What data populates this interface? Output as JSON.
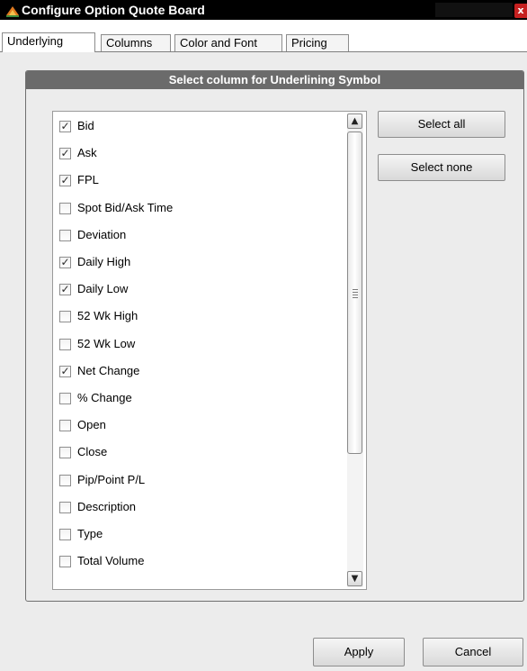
{
  "window": {
    "title": "Configure Option Quote Board",
    "close_glyph": "x",
    "icon": "app-logo-icon"
  },
  "tabs": [
    {
      "label": "Underlying",
      "active": true
    },
    {
      "label": "Columns",
      "active": false
    },
    {
      "label": "Color and Font",
      "active": false
    },
    {
      "label": "Pricing",
      "active": false
    }
  ],
  "panel": {
    "header": "Select column for Underlining Symbol"
  },
  "columns_list": {
    "check_glyph": "✓",
    "items": [
      {
        "label": "Bid",
        "checked": true
      },
      {
        "label": "Ask",
        "checked": true
      },
      {
        "label": "FPL",
        "checked": true
      },
      {
        "label": "Spot Bid/Ask Time",
        "checked": false
      },
      {
        "label": "Deviation",
        "checked": false
      },
      {
        "label": "Daily High",
        "checked": true
      },
      {
        "label": "Daily Low",
        "checked": true
      },
      {
        "label": "52 Wk High",
        "checked": false
      },
      {
        "label": "52 Wk Low",
        "checked": false
      },
      {
        "label": "Net Change",
        "checked": true
      },
      {
        "label": "% Change",
        "checked": false
      },
      {
        "label": "Open",
        "checked": false
      },
      {
        "label": "Close",
        "checked": false
      },
      {
        "label": "Pip/Point P/L",
        "checked": false
      },
      {
        "label": "Description",
        "checked": false
      },
      {
        "label": "Type",
        "checked": false
      },
      {
        "label": "Total Volume",
        "checked": false
      }
    ]
  },
  "scrollbar": {
    "up_glyph": "▲",
    "down_glyph": "▼"
  },
  "buttons": {
    "select_all": "Select all",
    "select_none": "Select none",
    "apply": "Apply",
    "cancel": "Cancel"
  },
  "colors": {
    "title_bar": "#000000",
    "panel_header": "#6b6b6b",
    "close_button": "#c62020"
  }
}
